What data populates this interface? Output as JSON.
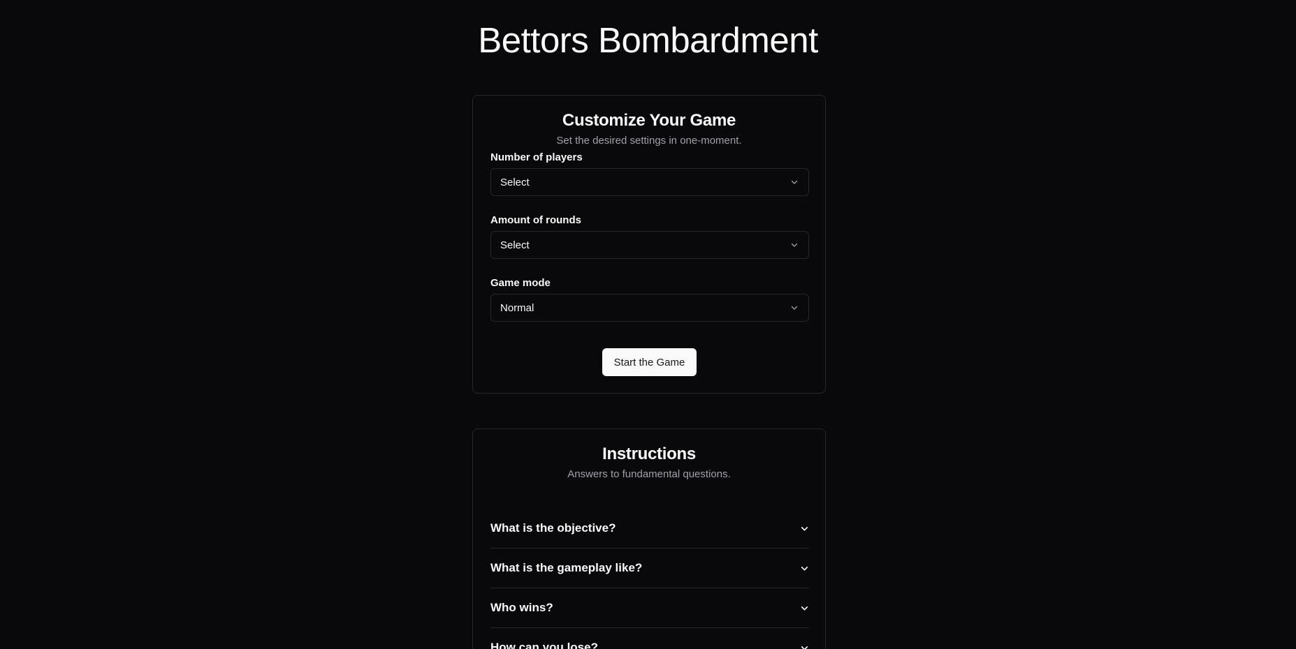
{
  "app": {
    "title": "Bettors Bombardment"
  },
  "settings": {
    "title": "Customize Your Game",
    "subtitle": "Set the desired settings in one-moment.",
    "fields": [
      {
        "label": "Number of players",
        "value": "Select"
      },
      {
        "label": "Amount of rounds",
        "value": "Select"
      },
      {
        "label": "Game mode",
        "value": "Normal"
      }
    ],
    "start_label": "Start the Game"
  },
  "instructions": {
    "title": "Instructions",
    "subtitle": "Answers to fundamental questions.",
    "questions": [
      "What is the objective?",
      "What is the gameplay like?",
      "Who wins?",
      "How can you lose?"
    ]
  },
  "icons": {
    "select_chevron": "chevron-down-icon",
    "faq_chevron": "chevron-down-icon"
  },
  "colors": {
    "background": "#09090b",
    "border": "#27272a",
    "text": "#fafafa",
    "muted": "#a1a1aa",
    "button_bg": "#fafafa"
  }
}
